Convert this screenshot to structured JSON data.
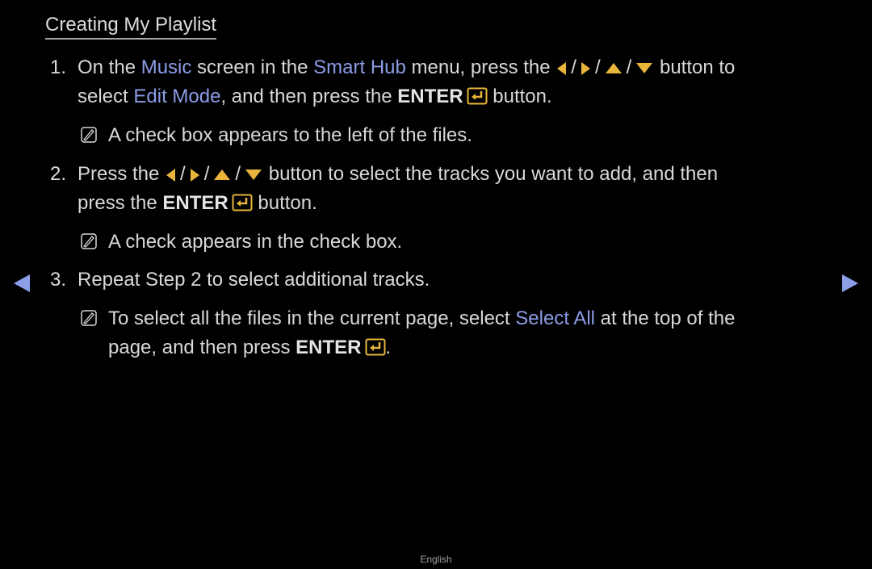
{
  "title": "Creating My Playlist",
  "colors": {
    "highlight": "#8c9ce6",
    "arrow_buttons": "#e8b53a",
    "nav_arrows": "#8d9fe8",
    "background": "#000000"
  },
  "steps": [
    {
      "number": "1.",
      "line1": {
        "t1": "On the ",
        "h1": "Music",
        "t2": " screen in the ",
        "h2": "Smart Hub",
        "t3": " menu, press the ",
        "t4": " button to"
      },
      "line2": {
        "t1": "select ",
        "h1": "Edit Mode",
        "t2": ", and then press the ",
        "b1": "ENTER",
        "t3": " button."
      },
      "note": "A check box appears to the left of the files."
    },
    {
      "number": "2.",
      "line1": {
        "t1": "Press the ",
        "t2": " button to select the tracks you want to add, and then"
      },
      "line2": {
        "t1": "press the ",
        "b1": "ENTER",
        "t2": " button."
      },
      "note": "A check appears in the check box."
    },
    {
      "number": "3.",
      "line1": {
        "t1": "Repeat Step 2 to select additional tracks."
      },
      "note_line1": {
        "t1": "To select all the files in the current page, select ",
        "h1": "Select All",
        "t2": " at the top of the"
      },
      "note_line2": {
        "t1": "page, and then press ",
        "b1": "ENTER",
        "t2": "."
      }
    }
  ],
  "icons": {
    "arrow_buttons": [
      "left-arrow-icon",
      "right-arrow-icon",
      "up-arrow-icon",
      "down-arrow-icon"
    ],
    "separator": "/",
    "enter": "enter-icon",
    "note": "note-icon"
  },
  "navigation": {
    "prev": "previous-page-arrow",
    "next": "next-page-arrow"
  },
  "footer": {
    "language": "English"
  }
}
